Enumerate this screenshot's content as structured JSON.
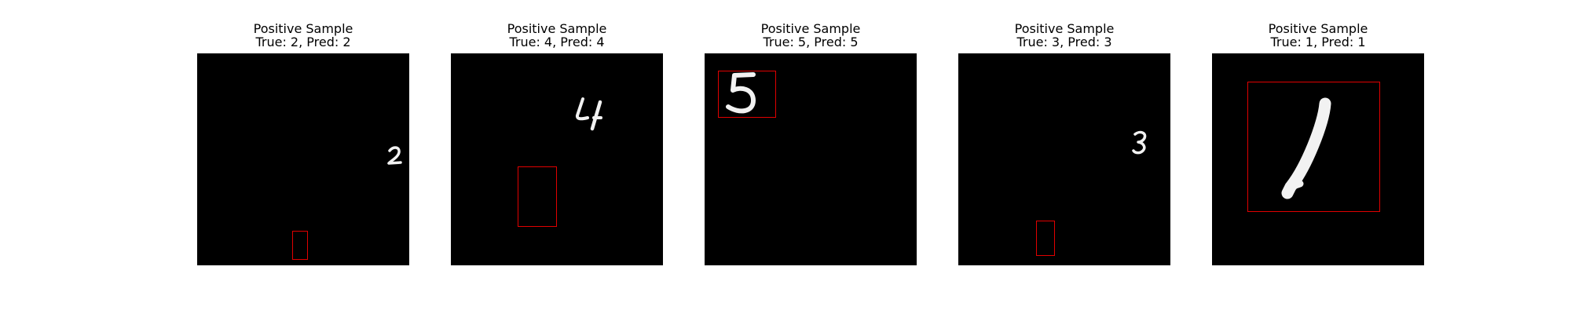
{
  "samples": [
    {
      "heading": "Positive Sample",
      "subtitle": "True: 2, Pred: 2",
      "digit": "2"
    },
    {
      "heading": "Positive Sample",
      "subtitle": "True: 4, Pred: 4",
      "digit": "4"
    },
    {
      "heading": "Positive Sample",
      "subtitle": "True: 5, Pred: 5",
      "digit": "5"
    },
    {
      "heading": "Positive Sample",
      "subtitle": "True: 3, Pred: 3",
      "digit": "3"
    },
    {
      "heading": "Positive Sample",
      "subtitle": "True: 1, Pred: 1",
      "digit": "1"
    }
  ],
  "colors": {
    "image_background": "#000000",
    "digit_stroke": "#f2f2f2",
    "box_stroke": "#e00000"
  }
}
